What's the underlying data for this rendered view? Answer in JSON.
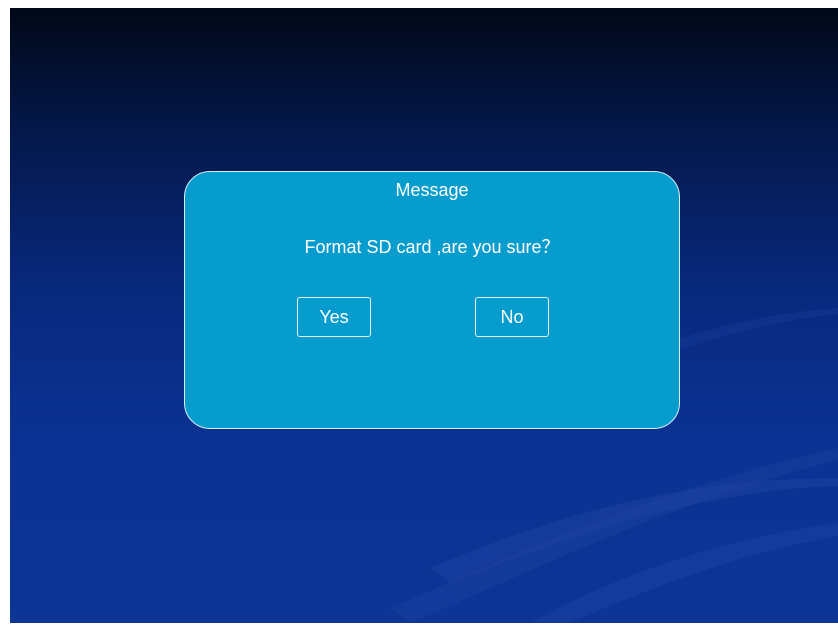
{
  "dialog": {
    "title": "Message",
    "message": "Format SD card ,are you sure？",
    "yes_label": "Yes",
    "no_label": "No"
  },
  "colors": {
    "background_top": "#010817",
    "background_bottom": "#0c3596",
    "dialog_fill": "#069ccd",
    "dialog_border": "#d7eef7",
    "text": "#ffffff"
  }
}
